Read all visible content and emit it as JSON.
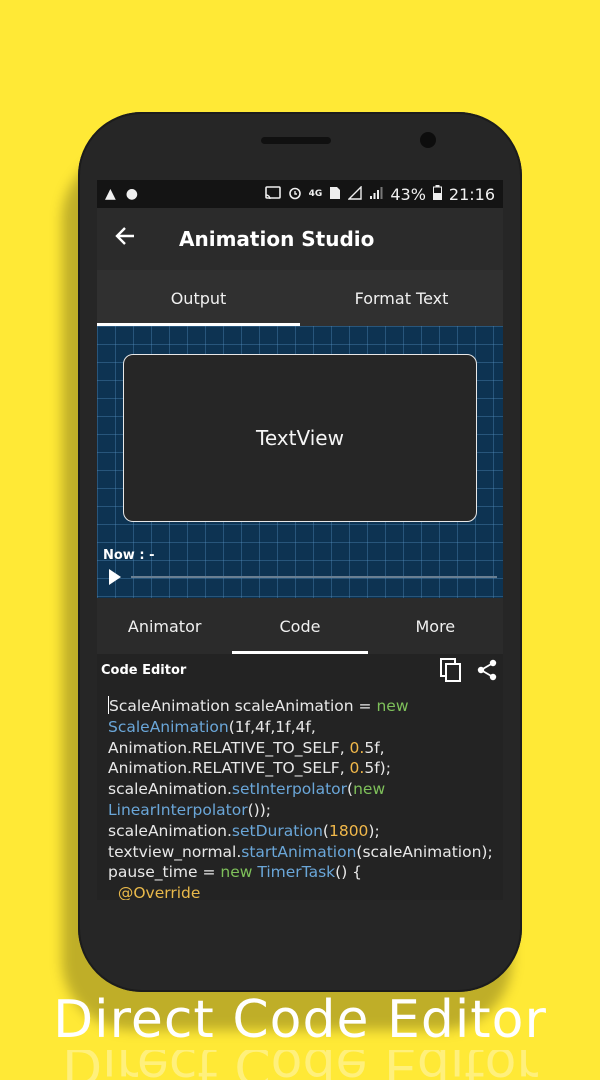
{
  "status_bar": {
    "battery": "43%",
    "time": "21:16"
  },
  "app_bar": {
    "title": "Animation Studio"
  },
  "top_tabs": [
    {
      "label": "Output",
      "active": true
    },
    {
      "label": "Format Text",
      "active": false
    }
  ],
  "output": {
    "textview_label": "TextView",
    "now_label": "Now : -"
  },
  "bottom_tabs": [
    {
      "label": "Animator",
      "active": false
    },
    {
      "label": "Code",
      "active": true
    },
    {
      "label": "More",
      "active": false
    }
  ],
  "editor": {
    "title": "Code Editor",
    "lines": [
      [
        {
          "t": "ScaleAnimation scaleAnimation = ",
          "c": ""
        },
        {
          "t": "new",
          "c": "kw"
        }
      ],
      [
        {
          "t": "ScaleAnimation",
          "c": "cls"
        },
        {
          "t": "(1f,4f,1f,4f,",
          "c": ""
        }
      ],
      [
        {
          "t": "Animation.RELATIVE_TO_SELF, ",
          "c": ""
        },
        {
          "t": "0.",
          "c": "num"
        },
        {
          "t": "5f,",
          "c": ""
        }
      ],
      [
        {
          "t": "Animation.RELATIVE_TO_SELF, ",
          "c": ""
        },
        {
          "t": "0.",
          "c": "num"
        },
        {
          "t": "5f);",
          "c": ""
        }
      ],
      [
        {
          "t": "scaleAnimation.",
          "c": ""
        },
        {
          "t": "setInterpolator",
          "c": "cls"
        },
        {
          "t": "(",
          "c": ""
        },
        {
          "t": "new",
          "c": "kw"
        }
      ],
      [
        {
          "t": "LinearInterpolator",
          "c": "cls"
        },
        {
          "t": "());",
          "c": ""
        }
      ],
      [
        {
          "t": "scaleAnimation.",
          "c": ""
        },
        {
          "t": "setDuration",
          "c": "cls"
        },
        {
          "t": "(",
          "c": ""
        },
        {
          "t": "1800",
          "c": "num"
        },
        {
          "t": ");",
          "c": ""
        }
      ],
      [
        {
          "t": "textview_normal.",
          "c": ""
        },
        {
          "t": "startAnimation",
          "c": "cls"
        },
        {
          "t": "(scaleAnimation);",
          "c": ""
        }
      ],
      [
        {
          "t": "pause_time = ",
          "c": ""
        },
        {
          "t": "new",
          "c": "kw"
        },
        {
          "t": " ",
          "c": ""
        },
        {
          "t": "TimerTask",
          "c": "cls"
        },
        {
          "t": "() {",
          "c": ""
        }
      ],
      [
        {
          "t": "  @Override",
          "c": "ann"
        }
      ]
    ]
  },
  "caption": "Direct Code Editor",
  "colors": {
    "background": "#FFE936",
    "grid": "#0d3352",
    "keyword": "#7ec05a",
    "method": "#6aa6d8",
    "number": "#f2b94a"
  }
}
